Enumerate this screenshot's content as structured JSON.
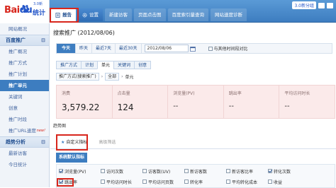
{
  "brand": {
    "logo_bai": "Bai",
    "logo_du": "du",
    "logo_sub": "统计",
    "version": "3.0新"
  },
  "topbar": {
    "version_badge": "3.0新分组"
  },
  "nav": [
    {
      "label": "报告",
      "state": "active",
      "icon": "report-icon"
    },
    {
      "label": "设置",
      "state": "report",
      "icon": "settings-icon"
    },
    {
      "label": "新建访客",
      "state": "plain"
    },
    {
      "label": "页面点击图",
      "state": "plain"
    },
    {
      "label": "百度索引量查询",
      "state": "plain"
    },
    {
      "label": "网站速度诊断",
      "state": "plain"
    }
  ],
  "sidebar": {
    "items": [
      {
        "type": "item",
        "label": "网站概况"
      },
      {
        "type": "group",
        "label": "百度推广",
        "toggle": "⊟"
      },
      {
        "type": "item",
        "label": "推广概况"
      },
      {
        "type": "item",
        "label": "推广方式"
      },
      {
        "type": "item",
        "label": "推广计划"
      },
      {
        "type": "item",
        "label": "推广单元",
        "active": true
      },
      {
        "type": "item",
        "label": "关键词"
      },
      {
        "type": "item",
        "label": "创意"
      },
      {
        "type": "item",
        "label": "推广时段"
      },
      {
        "type": "item",
        "label": "推广URL速度",
        "badge": "new!"
      },
      {
        "type": "group",
        "label": "趋势分析",
        "toggle": "⊟"
      },
      {
        "type": "item",
        "label": "最新访客"
      },
      {
        "type": "item",
        "label": "今日统计"
      }
    ]
  },
  "main": {
    "title": "搜索推广 (2012/08/06)",
    "date_buttons": [
      "今天",
      "昨天",
      "最近7天",
      "最近30天"
    ],
    "date_value": "2012/08/06",
    "compare_label": "与其他时间段对比",
    "tabs": [
      "推广方式",
      "计划",
      "单元",
      "关键词",
      "创意"
    ],
    "active_tab": 2,
    "crumbs": [
      "推广方式(搜索推广)",
      "全部",
      "单元"
    ],
    "metrics": [
      {
        "label": "消费",
        "value": "3,579.22"
      },
      {
        "label": "点击量",
        "value": "124"
      },
      {
        "label": "浏览量(PV)",
        "value": "--"
      },
      {
        "label": "跳出率",
        "value": "--"
      },
      {
        "label": "平均访问时长",
        "value": "--"
      }
    ],
    "trend_label": "趋势图",
    "subtabs": {
      "custom": "自定义指标",
      "filter": "高级筛选"
    },
    "selector_title": "系统默认指标",
    "selector_rows": [
      [
        {
          "label": "浏览量(PV)",
          "checked": true
        },
        {
          "label": "访问次数",
          "checked": false
        },
        {
          "label": "访客数(UV)",
          "checked": false
        },
        {
          "label": "新访客数",
          "checked": false
        },
        {
          "label": "新访客比率",
          "checked": false
        },
        {
          "label": "转化次数",
          "checked": true
        }
      ],
      [
        {
          "label": "跳出率",
          "checked": true
        },
        {
          "label": "平均访问时长",
          "checked": false
        },
        {
          "label": "平均访问页数",
          "checked": false
        },
        {
          "label": "转化率",
          "checked": false
        },
        {
          "label": "平均转化成本",
          "checked": false
        },
        {
          "label": "收益",
          "checked": false
        }
      ]
    ]
  },
  "colors": {
    "accent_blue": "#3d7dc0",
    "highlight_red": "#d8261c",
    "metric_bg": "#fbeaea"
  }
}
